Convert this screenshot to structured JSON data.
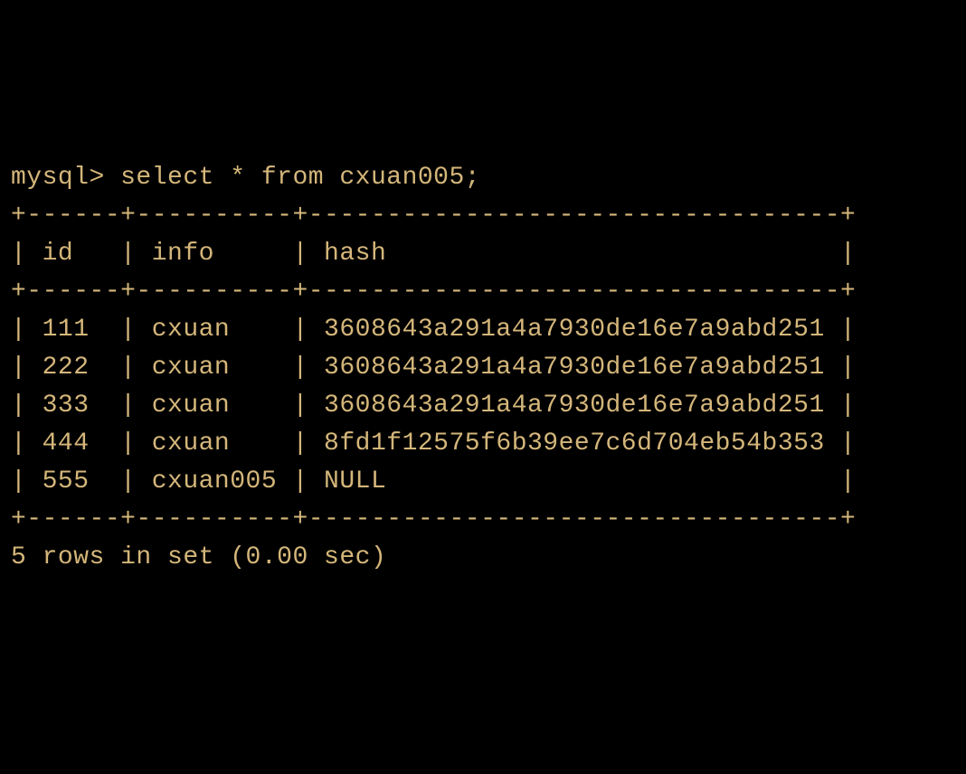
{
  "prompt": "mysql> ",
  "query": "select * from cxuan005;",
  "table": {
    "border_top": "+------+----------+----------------------------------+",
    "border_mid": "+------+----------+----------------------------------+",
    "border_bottom": "+------+----------+----------------------------------+",
    "columns": [
      "id",
      "info",
      "hash"
    ],
    "header_line": "| id   | info     | hash                             |",
    "rows": [
      {
        "id": "111",
        "info": "cxuan",
        "hash": "3608643a291a4a7930de16e7a9abd251"
      },
      {
        "id": "222",
        "info": "cxuan",
        "hash": "3608643a291a4a7930de16e7a9abd251"
      },
      {
        "id": "333",
        "info": "cxuan",
        "hash": "3608643a291a4a7930de16e7a9abd251"
      },
      {
        "id": "444",
        "info": "cxuan",
        "hash": "8fd1f12575f6b39ee7c6d704eb54b353"
      },
      {
        "id": "555",
        "info": "cxuan005",
        "hash": "NULL"
      }
    ],
    "row_lines": [
      "| 111  | cxuan    | 3608643a291a4a7930de16e7a9abd251 |",
      "| 222  | cxuan    | 3608643a291a4a7930de16e7a9abd251 |",
      "| 333  | cxuan    | 3608643a291a4a7930de16e7a9abd251 |",
      "| 444  | cxuan    | 8fd1f12575f6b39ee7c6d704eb54b353 |",
      "| 555  | cxuan005 | NULL                             |"
    ]
  },
  "footer": "5 rows in set (0.00 sec)"
}
